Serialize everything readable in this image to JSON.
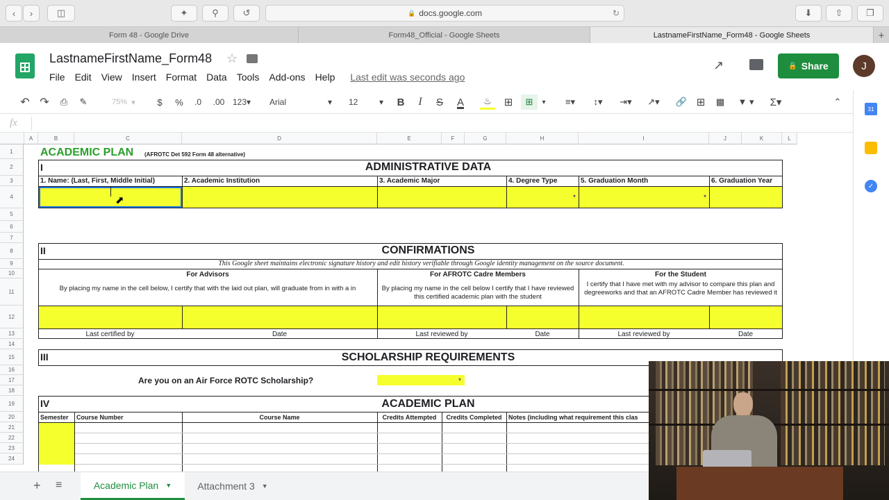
{
  "browser": {
    "url": "docs.google.com",
    "tabs": [
      "Form 48 - Google Drive",
      "Form48_Official - Google Sheets",
      "LastnameFirstName_Form48 - Google Sheets"
    ]
  },
  "doc": {
    "title": "LastnameFirstName_Form48",
    "menus": [
      "File",
      "Edit",
      "View",
      "Insert",
      "Format",
      "Data",
      "Tools",
      "Add-ons",
      "Help"
    ],
    "last_edit": "Last edit was seconds ago",
    "share": "Share",
    "avatar": "J"
  },
  "toolbar": {
    "zoom": "75%",
    "currency": "$",
    "percent": "%",
    "dec_less": ".0",
    "dec_more": ".00",
    "fmt": "123",
    "font": "Arial",
    "size": "12",
    "bold": "B",
    "italic": "I",
    "strike": "S",
    "textcolor": "A"
  },
  "formula": {
    "fx": "fx"
  },
  "grid": {
    "columns": [
      "A",
      "B",
      "C",
      "D",
      "E",
      "F",
      "G",
      "H",
      "I",
      "J",
      "K",
      "L"
    ],
    "rows": [
      "1",
      "2",
      "3",
      "4",
      "5",
      "6",
      "7",
      "8",
      "9",
      "10",
      "11",
      "12",
      "13",
      "14",
      "15",
      "16",
      "17",
      "18",
      "19",
      "20",
      "21",
      "22",
      "23",
      "24"
    ]
  },
  "sheet": {
    "title": "ACADEMIC PLAN",
    "title_note": "(AFROTC Det 592 Form 48 alternative)",
    "s1_num": "I",
    "s1_title": "ADMINISTRATIVE DATA",
    "s1_labels": [
      "1. Name: (Last, First, Middle Initial)",
      "2. Academic Institution",
      "3. Academic Major",
      "4. Degree Type",
      "5. Graduation Month",
      "6. Graduation Year"
    ],
    "s2_num": "II",
    "s2_title": "CONFIRMATIONS",
    "s2_note": "This Google sheet maintains electronic signature history and edit history verifiable through Google identity management on the source document.",
    "advisors_head": "For Advisors",
    "advisors_text": "By placing my name in the cell below, I certify that with the laid out plan,   will graduate from  in   with a in",
    "cadre_head": "For AFROTC Cadre Members",
    "cadre_text": "By placing my name in the cell below I certify that I have reviewed this certified academic plan with the student",
    "student_head": "For the Student",
    "student_text": "I certify that I have met with my advisor to compare this plan and degreeworks and that an AFROTC Cadre Member has reviewed it",
    "foot": [
      "Last certified by",
      "Date",
      "Last reviewed by",
      "Date",
      "Last reviewed by",
      "Date"
    ],
    "s3_num": "III",
    "s3_title": "SCHOLARSHIP REQUIREMENTS",
    "scholarship_q": "Are you on an Air Force ROTC Scholarship?",
    "s4_num": "IV",
    "s4_title": "ACADEMIC PLAN",
    "plan_cols": [
      "Semester",
      "Course Number",
      "Course Name",
      "Credits Attempted",
      "Credits Completed",
      "Notes (including what requirement this clas"
    ]
  },
  "sheets": {
    "tabs": [
      "Academic Plan",
      "Attachment 3"
    ]
  }
}
